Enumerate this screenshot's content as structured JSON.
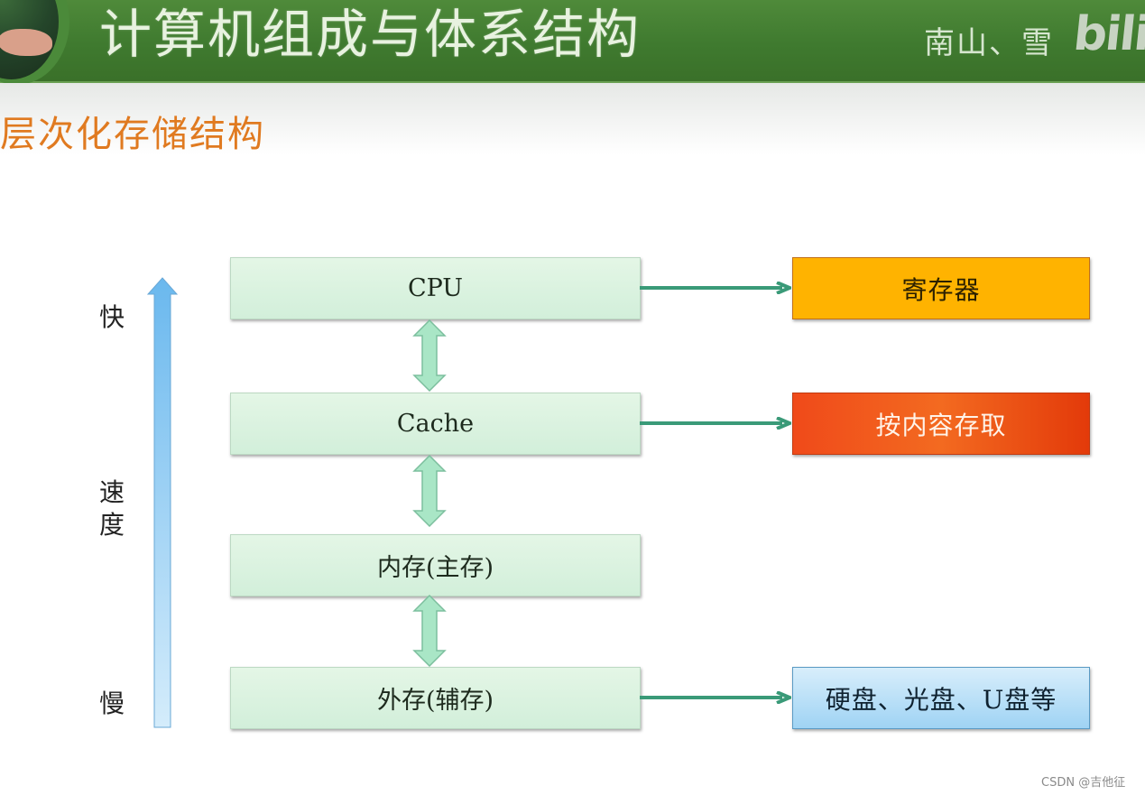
{
  "header": {
    "title": "计算机组成与体系结构",
    "author": "南山、雪",
    "logo_text": "bili"
  },
  "section_title": "层次化存储结构",
  "speed_axis": {
    "fast_label": "快",
    "axis_label_line1": "速",
    "axis_label_line2": "度",
    "slow_label": "慢",
    "arrow_color": "#7cc4f0"
  },
  "levels": [
    {
      "label": "CPU",
      "side": "寄存器",
      "side_color": "#ffb300"
    },
    {
      "label": "Cache",
      "side": "按内容存取",
      "side_color": "#f04a1a"
    },
    {
      "label": "内存(主存)",
      "side": null
    },
    {
      "label": "外存(辅存)",
      "side": "硬盘、光盘、U盘等",
      "side_color": "#9fd3f4"
    }
  ],
  "connector_color": "#3a9a78",
  "watermark": "CSDN @吉他征"
}
